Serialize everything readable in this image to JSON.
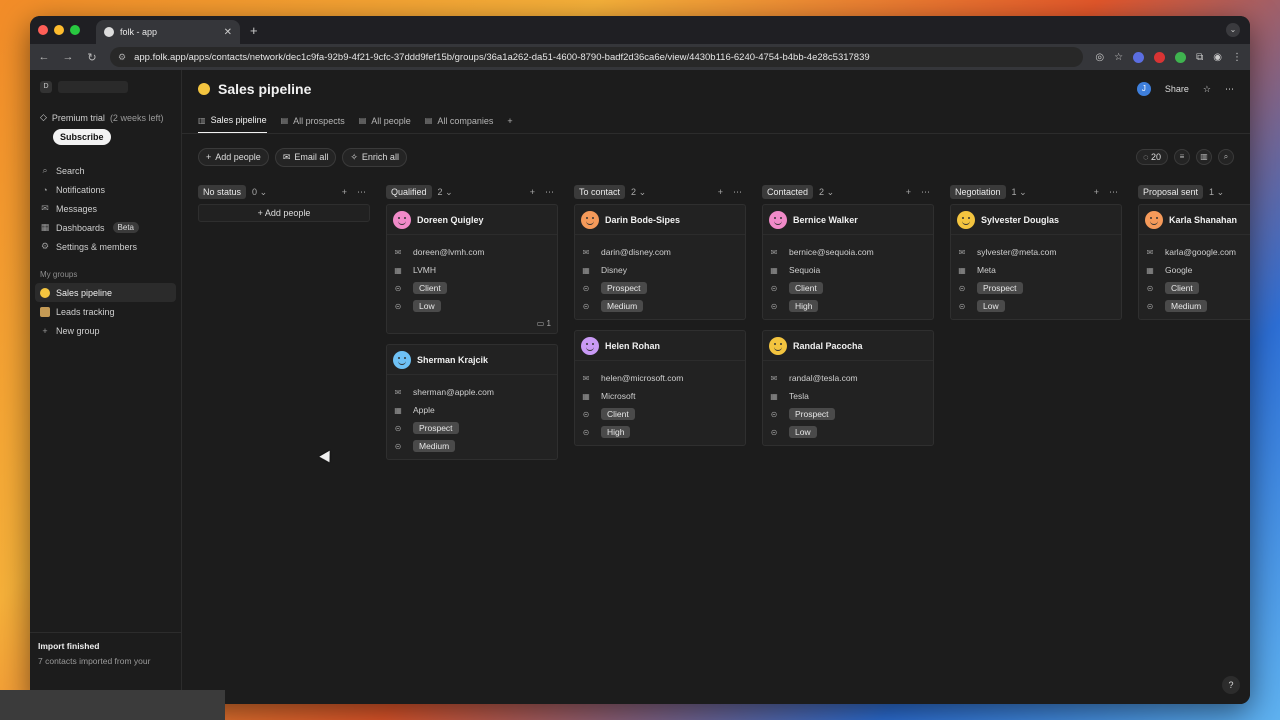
{
  "browser": {
    "tab_title": "folk - app",
    "url": "app.folk.app/apps/contacts/network/dec1c9fa-92b9-4f21-9cfc-37ddd9fef15b/groups/36a1a262-da51-4600-8790-badf2d36ca6e/view/4430b116-6240-4754-b4bb-4e28c5317839"
  },
  "sidebar": {
    "workspace_initial": "D",
    "trial_label": "Premium trial",
    "trial_remaining": "(2 weeks left)",
    "subscribe_label": "Subscribe",
    "items": [
      {
        "icon": "search-icon",
        "label": "Search"
      },
      {
        "icon": "bell-icon",
        "label": "Notifications"
      },
      {
        "icon": "mail-icon",
        "label": "Messages"
      },
      {
        "icon": "chart-icon",
        "label": "Dashboards",
        "badge": "Beta"
      },
      {
        "icon": "gear-icon",
        "label": "Settings & members"
      }
    ],
    "groups_title": "My groups",
    "groups": [
      {
        "label": "Sales pipeline",
        "active": true
      },
      {
        "label": "Leads tracking",
        "active": false
      },
      {
        "label": "New group",
        "active": false
      }
    ],
    "import_title": "Import finished",
    "import_subtitle": "7 contacts imported from your"
  },
  "header": {
    "title": "Sales pipeline",
    "avatar": "J",
    "share_label": "Share"
  },
  "views": [
    "Sales pipeline",
    "All prospects",
    "All people",
    "All companies"
  ],
  "toolbar": {
    "add_people": "Add people",
    "email_all": "Email all",
    "enrich_all": "Enrich all",
    "hidden_count": "20"
  },
  "board": {
    "add_people_label": "Add people",
    "columns": [
      {
        "name": "No status",
        "count": "0",
        "cards": []
      },
      {
        "name": "Qualified",
        "count": "2",
        "cards": [
          {
            "name": "Doreen Quigley",
            "email": "doreen@lvmh.com",
            "company": "LVMH",
            "type": "Client",
            "priority": "Low",
            "color": "#f08ac8",
            "comments": "1"
          },
          {
            "name": "Sherman Krajcik",
            "email": "sherman@apple.com",
            "company": "Apple",
            "type": "Prospect",
            "priority": "Medium",
            "color": "#6ec1f5"
          }
        ]
      },
      {
        "name": "To contact",
        "count": "2",
        "cards": [
          {
            "name": "Darin Bode-Sipes",
            "email": "darin@disney.com",
            "company": "Disney",
            "type": "Prospect",
            "priority": "Medium",
            "color": "#f59a5a"
          },
          {
            "name": "Helen Rohan",
            "email": "helen@microsoft.com",
            "company": "Microsoft",
            "type": "Client",
            "priority": "High",
            "color": "#c99af5"
          }
        ]
      },
      {
        "name": "Contacted",
        "count": "2",
        "cards": [
          {
            "name": "Bernice Walker",
            "email": "bernice@sequoia.com",
            "company": "Sequoia",
            "type": "Client",
            "priority": "High",
            "color": "#f08ac8"
          },
          {
            "name": "Randal Pacocha",
            "email": "randal@tesla.com",
            "company": "Tesla",
            "type": "Prospect",
            "priority": "Low",
            "color": "#f3c43f"
          }
        ]
      },
      {
        "name": "Negotiation",
        "count": "1",
        "cards": [
          {
            "name": "Sylvester Douglas",
            "email": "sylvester@meta.com",
            "company": "Meta",
            "type": "Prospect",
            "priority": "Low",
            "color": "#f3c43f"
          }
        ]
      },
      {
        "name": "Proposal sent",
        "count": "1",
        "cards": [
          {
            "name": "Karla Shanahan",
            "email": "karla@google.com",
            "company": "Google",
            "type": "Client",
            "priority": "Medium",
            "color": "#f59a5a"
          }
        ]
      }
    ]
  },
  "help_label": "?"
}
